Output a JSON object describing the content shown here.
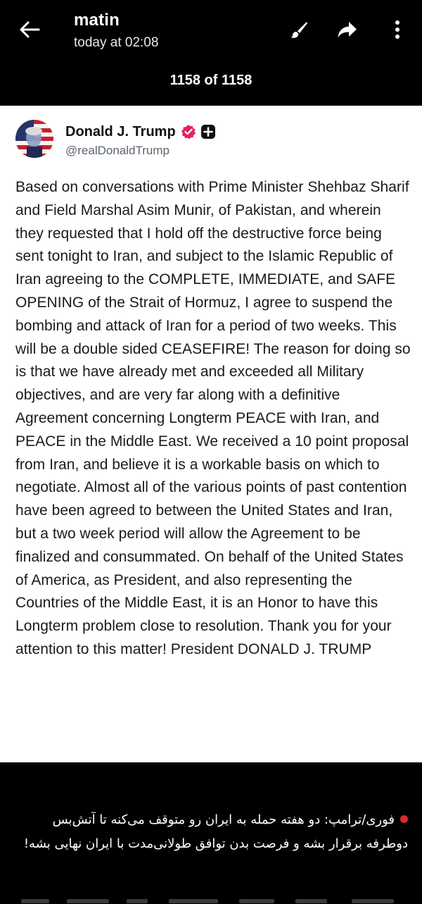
{
  "header": {
    "sender": "matin",
    "timestamp": "today at 02:08",
    "back_icon": "arrow-left-icon",
    "actions": [
      "brush-icon",
      "share-forward-icon",
      "more-vert-icon"
    ]
  },
  "counter": "1158 of 1158",
  "post": {
    "author_name": "Donald J. Trump",
    "handle": "@realDonaldTrump",
    "badges": [
      "verified-icon",
      "plus-icon"
    ],
    "text": "Based on conversations with Prime Minister Shehbaz Sharif and Field Marshal Asim Munir, of Pakistan, and wherein they requested that I hold off the destructive force being sent tonight to Iran, and subject to the Islamic Republic of Iran agreeing to the COMPLETE, IMMEDIATE, and SAFE OPENING of the Strait of Hormuz, I agree to suspend the bombing and attack of Iran for a period of two weeks. This will be a double sided CEASEFIRE! The reason for doing so is that we have already met and exceeded all Military objectives, and are very far along with a definitive Agreement concerning Longterm PEACE with Iran, and PEACE in the Middle East. We received a 10 point proposal from Iran, and believe it is a workable basis on which to negotiate. Almost all of the various points of past contention have been agreed to between the United States and Iran, but a two week period will allow the Agreement to be finalized and consummated. On behalf of the United States of America, as President, and also representing the Countries of the Middle East, it is an Honor to have this Longterm problem close to resolution. Thank you for your attention to this matter! President DONALD J. TRUMP"
  },
  "caption": {
    "text": "فوری/ترامپ: دو هفته حمله به ایران رو متوقف می‌کنه تا آتش‌بس دوطرفه برقرار بشه و فرصت بدن توافق طولانی‌مدت با ایران نهایی بشه!"
  },
  "colors": {
    "background": "#000000",
    "card": "#ffffff",
    "verified": "#e0245e",
    "caption_dot": "#e0262b"
  }
}
